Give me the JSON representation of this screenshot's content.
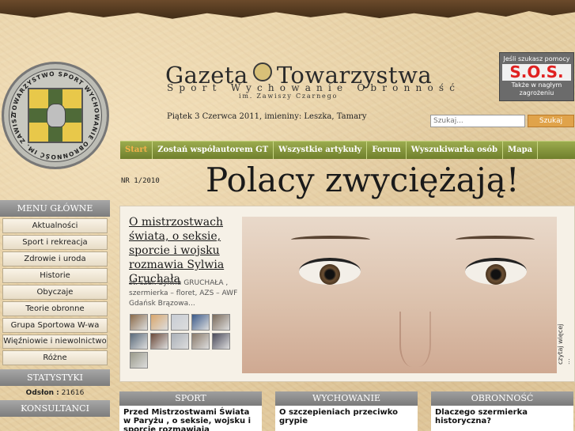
{
  "masthead": {
    "title_left": "Gazeta",
    "title_right": "Towarzystwa",
    "subtitle": "Sport Wychowanie Obronność",
    "subtitle2": "im. Zawiszy Czarnego",
    "date_line": "Piątek 3 Czerwca 2011, imieniny: Leszka, Tamary"
  },
  "emblem": {
    "ring_text": "TOWARZYSTWO SPORT WYCHOWANIE OBRONNOŚĆ IM. ZAWISZY CZARNEGO"
  },
  "sos": {
    "line1": "Jeśli szukasz pomocy",
    "label": "S.O.S.",
    "line3": "Także w nagłym zagrożeniu"
  },
  "search": {
    "placeholder": "Szukaj...",
    "button": "Szukaj"
  },
  "topnav": {
    "items": [
      "Start",
      "Zostań współautorem GT",
      "Wszystkie artykuły",
      "Forum",
      "Wyszukiwarka osób",
      "Mapa"
    ]
  },
  "issue": "NR 1/2010",
  "headline": "Polacy zwyciężają!",
  "sidebar": {
    "menu_header": "MENU GŁÓWNE",
    "items": [
      "Aktualności",
      "Sport i rekreacja",
      "Zdrowie i uroda",
      "Historie",
      "Obyczaje",
      "Teorie obronne",
      "Grupa Sportowa W-wa",
      "Więźniowie i niewolnictwo",
      "Różne"
    ],
    "stats_header": "STATYSTYKI",
    "stats_label": "Odsłon :",
    "stats_value": "21616",
    "consult_header": "KONSULTANCI"
  },
  "feature": {
    "title": "O mistrzostwach świata, o seksie, sporcie i wojsku rozmawia Sylwia Gruchała",
    "teaser": "st. szer. Sylwia GRUCHAŁA , szermierka – floret, AZS – AWF Gdańsk Brązowa...",
    "read_more": "czytaj więcej ...",
    "thumb_colors": [
      "#8b6b4a",
      "#d9a66b",
      "#c7ccd4",
      "#3b5a8a",
      "#7a6a5a",
      "#5a6a7a",
      "#6b4a3a",
      "#aab0b8",
      "#8a7a6a",
      "#4a4a5a",
      "#9a9a8a"
    ]
  },
  "categories": [
    {
      "title": "SPORT",
      "article": "Przed Mistrzostwami Świata w Paryżu , o seksie, wojsku i sporcie rozmawiają Aleksandra"
    },
    {
      "title": "WYCHOWANIE",
      "article": "O szczepieniach przeciwko grypie"
    },
    {
      "title": "OBRONNOŚĆ",
      "article": "Dlaczego szermierka historyczna?"
    }
  ],
  "colors": {
    "nav_green": "#8a9a3e",
    "nav_active": "#f3b14a",
    "sos_red": "#e02020",
    "search_button": "#e0a34a"
  }
}
